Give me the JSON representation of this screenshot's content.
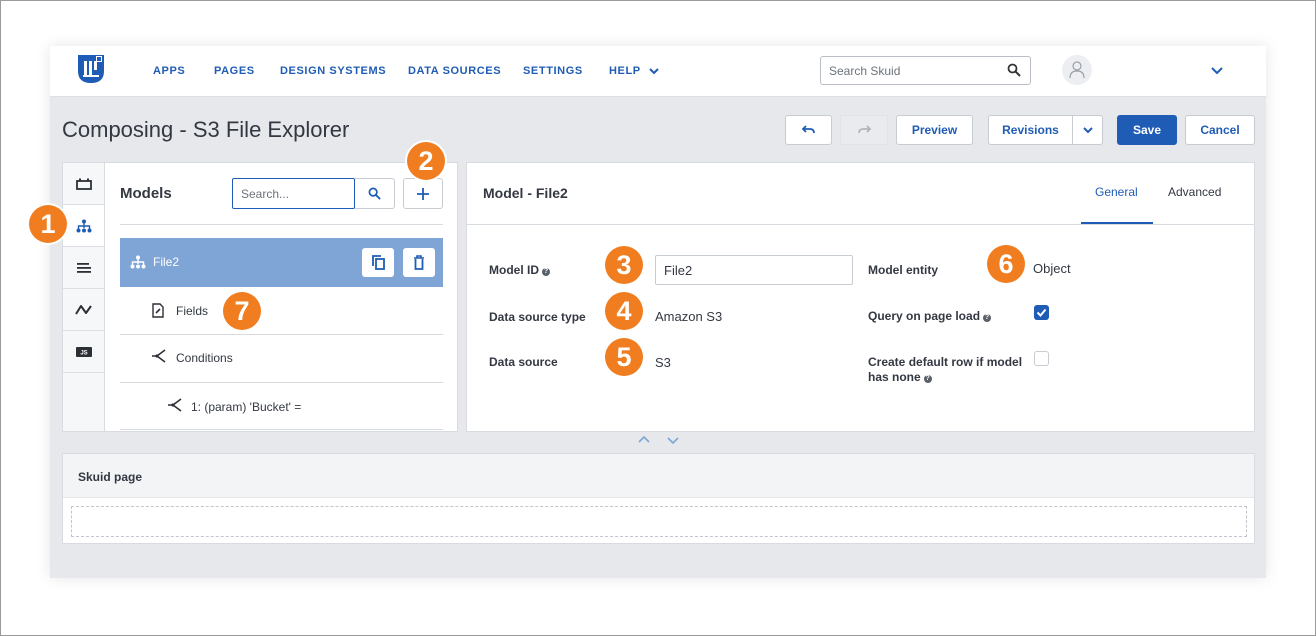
{
  "nav": {
    "items": [
      "APPS",
      "PAGES",
      "DESIGN SYSTEMS",
      "DATA SOURCES",
      "SETTINGS",
      "HELP"
    ],
    "search_placeholder": "Search Skuid"
  },
  "toolbar": {
    "title": "Composing - S3 File Explorer",
    "preview_label": "Preview",
    "revisions_label": "Revisions",
    "save_label": "Save",
    "cancel_label": "Cancel"
  },
  "models_panel": {
    "title": "Models",
    "search_placeholder": "Search...",
    "selected_model": "File2",
    "tree": {
      "fields": "Fields",
      "conditions": "Conditions",
      "condition_1": "1: (param) 'Bucket' ="
    }
  },
  "model_detail": {
    "title": "Model - File2",
    "tabs": [
      "General",
      "Advanced"
    ],
    "active_tab": "General",
    "model_id_label": "Model ID",
    "model_id_value": "File2",
    "data_source_type_label": "Data source type",
    "data_source_type_value": "Amazon S3",
    "data_source_label": "Data source",
    "data_source_value": "S3",
    "model_entity_label": "Model entity",
    "model_entity_value": "Object",
    "query_on_load_label": "Query on page load",
    "query_on_load_checked": true,
    "create_default_row_label_1": "Create default row if model",
    "create_default_row_label_2": "has none",
    "create_default_row_checked": false
  },
  "skuid_page": {
    "title": "Skuid page"
  },
  "callouts": [
    "1",
    "2",
    "3",
    "4",
    "5",
    "6",
    "7"
  ],
  "icons": {
    "rail": [
      "component-icon",
      "models-icon",
      "list-icon",
      "actions-icon",
      "javascript-icon"
    ],
    "help": "?",
    "js": "JS"
  },
  "colors": {
    "brand_blue": "#1f5cb5",
    "selected_row": "#7fa4d6",
    "callout_orange": "#f07d1f"
  }
}
